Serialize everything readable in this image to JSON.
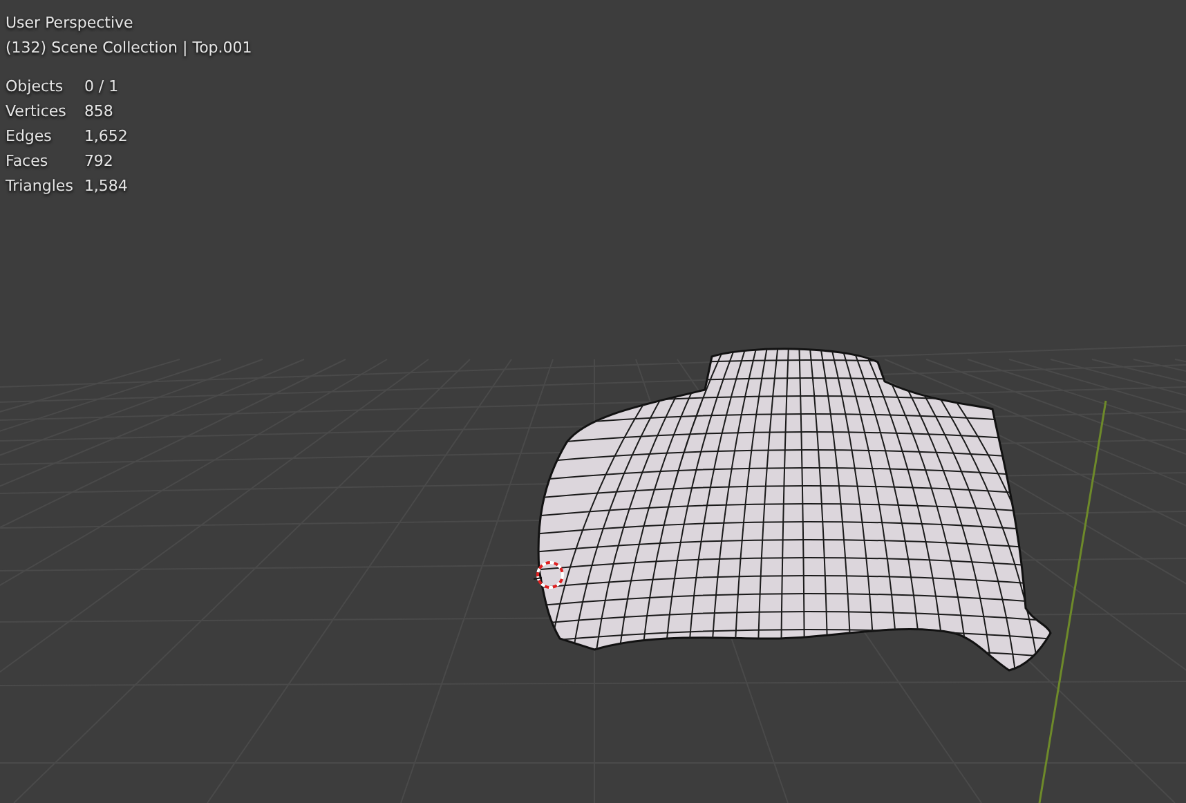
{
  "viewport": {
    "view_name": "User Perspective",
    "collection_line": "(132) Scene Collection | Top.001",
    "stats": [
      {
        "label": "Objects",
        "value": "0 / 1"
      },
      {
        "label": "Vertices",
        "value": "858"
      },
      {
        "label": "Edges",
        "value": "1,652"
      },
      {
        "label": "Faces",
        "value": "792"
      },
      {
        "label": "Triangles",
        "value": "1,584"
      }
    ]
  }
}
